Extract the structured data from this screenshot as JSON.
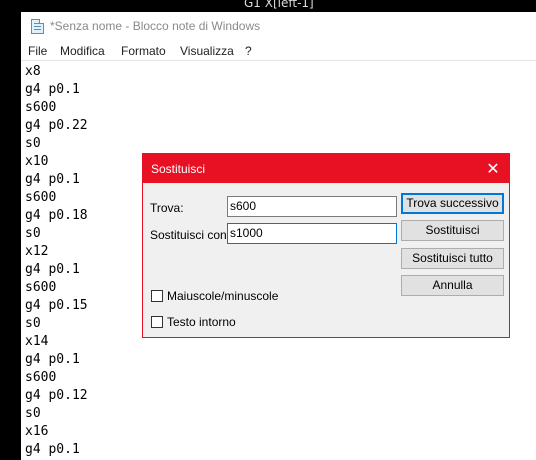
{
  "background": {
    "text": "G1 X[left-1]"
  },
  "window": {
    "title": "*Senza nome - Blocco note di Windows",
    "menu": [
      "File",
      "Modifica",
      "Formato",
      "Visualizza",
      "?"
    ]
  },
  "editor": {
    "lines": [
      "x8",
      "g4 p0.1",
      "s600",
      "g4 p0.22",
      "s0",
      "x10",
      "g4 p0.1",
      "s600",
      "g4 p0.18",
      "s0",
      "x12",
      "g4 p0.1",
      "s600",
      "g4 p0.15",
      "s0",
      "x14",
      "g4 p0.1",
      "s600",
      "g4 p0.12",
      "s0",
      "x16",
      "g4 p0.1"
    ]
  },
  "dialog": {
    "title": "Sostituisci",
    "close_glyph": "✕",
    "find_label": "Trova:",
    "find_value": "s600",
    "replace_label": "Sostituisci con:",
    "replace_value": "s1000",
    "buttons": {
      "find_next": "Trova successivo",
      "replace": "Sostituisci",
      "replace_all": "Sostituisci tutto",
      "cancel": "Annulla"
    },
    "match_case": {
      "label": "Maiuscole/minuscole",
      "checked": false
    },
    "wrap_around": {
      "label": "Testo intorno",
      "checked": false
    }
  },
  "colors": {
    "dialog_accent": "#e81123",
    "focus_border": "#0078d7"
  }
}
